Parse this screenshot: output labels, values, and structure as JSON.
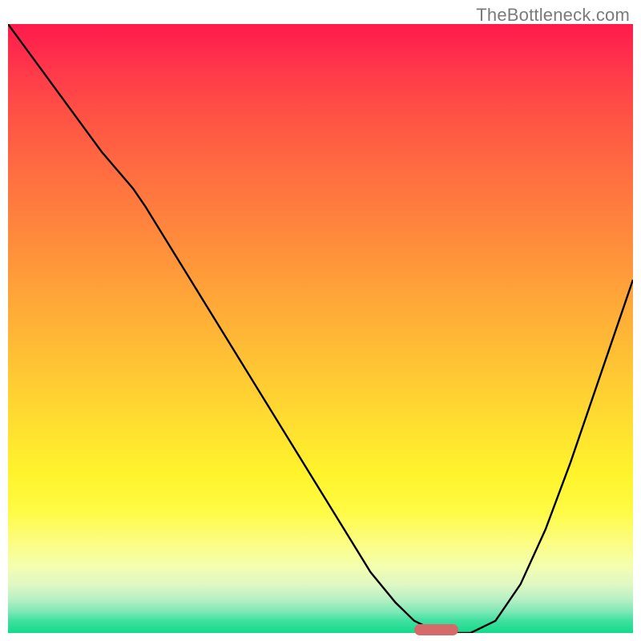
{
  "watermark": "TheBottleneck.com",
  "chart_data": {
    "type": "line",
    "x": [
      0.0,
      0.05,
      0.1,
      0.15,
      0.2,
      0.22,
      0.28,
      0.34,
      0.4,
      0.46,
      0.52,
      0.58,
      0.62,
      0.65,
      0.68,
      0.7,
      0.74,
      0.78,
      0.82,
      0.86,
      0.9,
      0.94,
      0.98,
      1.0
    ],
    "values": [
      1.0,
      0.93,
      0.86,
      0.79,
      0.73,
      0.7,
      0.6,
      0.5,
      0.4,
      0.3,
      0.2,
      0.1,
      0.05,
      0.02,
      0.005,
      0.0,
      0.0,
      0.02,
      0.08,
      0.17,
      0.28,
      0.4,
      0.52,
      0.58
    ],
    "title": "",
    "xlabel": "",
    "ylabel": "",
    "xlim": [
      0,
      1
    ],
    "ylim": [
      0,
      1
    ],
    "marker": {
      "x_start": 0.65,
      "x_end": 0.72,
      "y": 0.005
    }
  },
  "colors": {
    "gradient_top": "#ff1a4d",
    "gradient_mid": "#ffdf30",
    "gradient_bottom": "#14da8a",
    "curve": "#000000",
    "marker": "#d46a6a",
    "watermark": "#7a7a7a"
  }
}
